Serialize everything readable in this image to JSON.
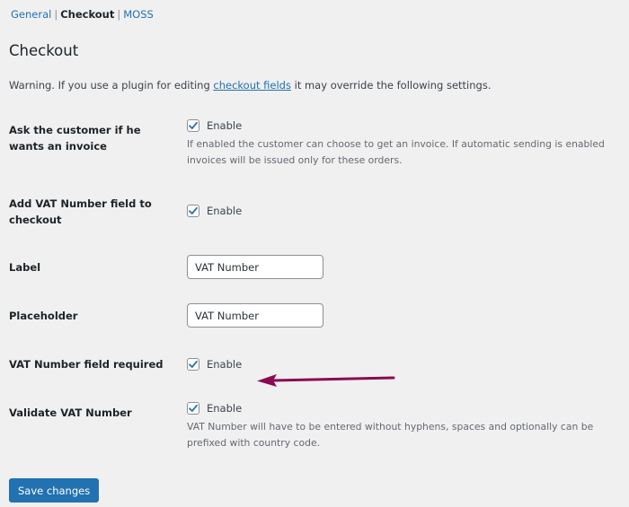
{
  "subnav": {
    "items": [
      {
        "label": "General",
        "current": false
      },
      {
        "label": "Checkout",
        "current": true
      },
      {
        "label": "MOSS",
        "current": false
      }
    ],
    "separator": "|"
  },
  "page_title": "Checkout",
  "warning": {
    "before": "Warning. If you use a plugin for editing ",
    "link": "checkout fields",
    "after": " it may override the following settings."
  },
  "settings": {
    "ask_invoice": {
      "label": "Ask the customer if he wants an invoice",
      "checkbox_label": "Enable",
      "checked": true,
      "description": "If enabled the customer can choose to get an invoice. If automatic sending is enabled invoices will be issued only for these orders."
    },
    "add_vat_field": {
      "label": "Add VAT Number field to checkout",
      "checkbox_label": "Enable",
      "checked": true
    },
    "field_label": {
      "label": "Label",
      "value": "VAT Number"
    },
    "field_placeholder": {
      "label": "Placeholder",
      "value": "VAT Number"
    },
    "vat_required": {
      "label": "VAT Number field required",
      "checkbox_label": "Enable",
      "checked": true
    },
    "validate_vat": {
      "label": "Validate VAT Number",
      "checkbox_label": "Enable",
      "checked": true,
      "description": "VAT Number will have to be entered without hyphens, spaces and optionally can be prefixed with country code."
    }
  },
  "annotation": {
    "arrow_color": "#8b0a50"
  },
  "save_button": "Save changes",
  "colors": {
    "accent": "#2271b1",
    "background": "#f0f0f1"
  }
}
